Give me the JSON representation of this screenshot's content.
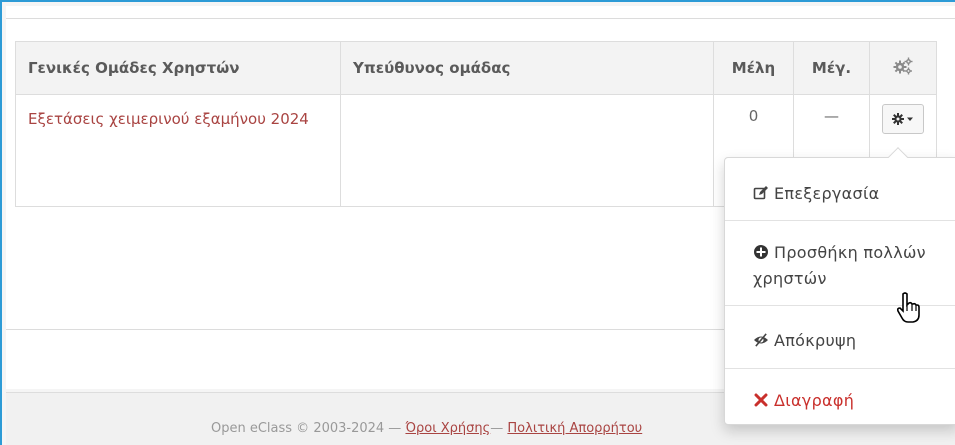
{
  "table": {
    "headers": {
      "name": "Γενικές Ομάδες Χρηστών",
      "owner": "Υπεύθυνος ομάδας",
      "members": "Μέλη",
      "max": "Μέγ.",
      "actions_icon": "cogs-icon"
    },
    "rows": [
      {
        "name": "Εξετάσεις χειμερινού εξαμήνου 2024",
        "owner": "",
        "members": "0",
        "max": "—",
        "action_icon": "cog-icon"
      }
    ]
  },
  "dropdown": {
    "items": [
      {
        "label": "Επεξεργασία",
        "icon": "edit-icon"
      },
      {
        "label": "Προσθήκη πολλών χρηστών",
        "icon": "plus-circle-icon"
      },
      {
        "label": "Απόκρυψη",
        "icon": "eye-slash-icon"
      },
      {
        "label": "Διαγραφή",
        "icon": "times-icon"
      }
    ],
    "delete_color": "#c9302c"
  },
  "footer": {
    "copyright": "Open eClass © 2003-2024 — ",
    "terms": "Όροι Χρήσης",
    "sep": "— ",
    "privacy": "Πολιτική Απορρήτου"
  },
  "colors": {
    "link": "#a94442",
    "frame_border": "#2d9bd6"
  }
}
